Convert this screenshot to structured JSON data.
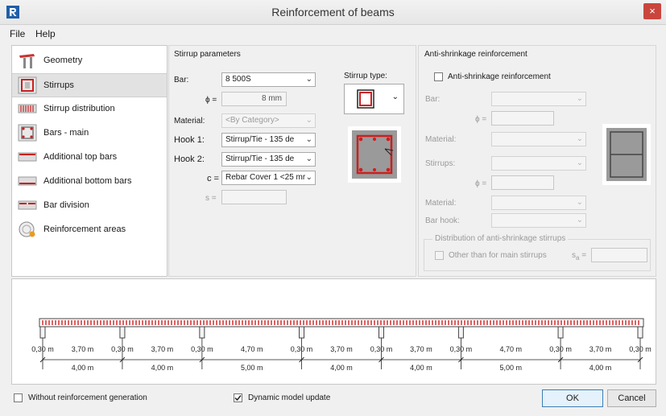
{
  "window": {
    "title": "Reinforcement of beams",
    "close_glyph": "×"
  },
  "menu": [
    {
      "label": "File"
    },
    {
      "label": "Help"
    }
  ],
  "nav": {
    "items": [
      {
        "label": "Geometry",
        "icon": "geometry-icon"
      },
      {
        "label": "Stirrups",
        "icon": "stirrups-icon",
        "selected": true
      },
      {
        "label": "Stirrup distribution",
        "icon": "stirrup-distribution-icon"
      },
      {
        "label": "Bars - main",
        "icon": "bars-main-icon"
      },
      {
        "label": "Additional top bars",
        "icon": "additional-top-bars-icon"
      },
      {
        "label": "Additional bottom bars",
        "icon": "additional-bottom-bars-icon"
      },
      {
        "label": "Bar division",
        "icon": "bar-division-icon"
      },
      {
        "label": "Reinforcement areas",
        "icon": "reinforcement-areas-icon"
      }
    ]
  },
  "stirrup": {
    "group_title": "Stirrup parameters",
    "bar_label": "Bar:",
    "bar_value": "8 500S",
    "phi_label": "ϕ =",
    "phi_value": "8 mm",
    "material_label": "Material:",
    "material_value": "<By Category>",
    "hook1_label": "Hook 1:",
    "hook1_value": "Stirrup/Tie - 135 de",
    "hook2_label": "Hook 2:",
    "hook2_value": "Stirrup/Tie - 135 de",
    "c_label": "c =",
    "c_value": "Rebar Cover 1 <25 mr",
    "s_label": "s =",
    "s_value": "",
    "type_label": "Stirrup type:"
  },
  "anti": {
    "group_title": "Anti-shrinkage reinforcement",
    "checkbox_label": "Anti-shrinkage reinforcement",
    "checked": false,
    "bar_label": "Bar:",
    "phi_label": "ϕ =",
    "material_label": "Material:",
    "stirrups_label": "Stirrups:",
    "phi2_label": "ϕ =",
    "material2_label": "Material:",
    "barhook_label": "Bar hook:",
    "distribution_title": "Distribution of anti-shrinkage stirrups",
    "other_label": "Other than for main stirrups",
    "s_label": "s",
    "s_sub": "a",
    "s_eq": "="
  },
  "beam": {
    "supports": [
      "0,30 m",
      "0,30 m",
      "0,30 m",
      "0,30 m",
      "0,30 m",
      "0,30 m",
      "0,30 m",
      "0,30 m"
    ],
    "clear_spans": [
      "3,70 m",
      "3,70 m",
      "4,70 m",
      "3,70 m",
      "3,70 m",
      "4,70 m",
      "3,70 m"
    ],
    "spans": [
      "4,00 m",
      "4,00 m",
      "5,00 m",
      "4,00 m",
      "4,00 m",
      "5,00 m",
      "4,00 m"
    ],
    "span_lengths": [
      4,
      4,
      5,
      4,
      4,
      5,
      4
    ]
  },
  "footer": {
    "no_generation_label": "Without reinforcement generation",
    "no_generation_checked": false,
    "dynamic_label": "Dynamic model update",
    "dynamic_checked": true,
    "ok_label": "OK",
    "cancel_label": "Cancel"
  },
  "colors": {
    "accent": "#c9463d",
    "rebar": "#cc1f1f"
  }
}
